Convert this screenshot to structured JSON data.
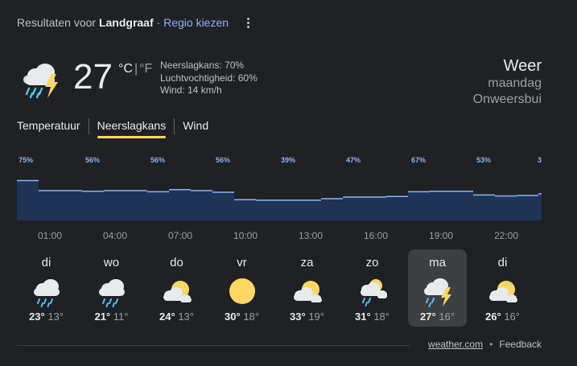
{
  "header": {
    "results_prefix": "Resultaten voor",
    "location": "Landgraaf",
    "separator": "·",
    "region_link": "Regio kiezen",
    "more_icon": "more-vert-icon"
  },
  "current": {
    "icon": "thunderstorm-icon",
    "temperature": "27",
    "unit_c": "°C",
    "unit_sep": "|",
    "unit_f": "°F",
    "precipitation": "Neerslagkans: 70%",
    "humidity": "Luchtvochtigheid: 60%",
    "wind": "Wind: 14 km/h"
  },
  "summary": {
    "title": "Weer",
    "day": "maandag",
    "condition": "Onweersbui"
  },
  "tabs": [
    {
      "label": "Temperatuur"
    },
    {
      "label": "Neerslagkans"
    },
    {
      "label": "Wind"
    }
  ],
  "active_tab": "Neerslagkans",
  "chart_data": {
    "type": "area",
    "series": [
      {
        "values": [
          75,
          56,
          56,
          55,
          56,
          56,
          54,
          58,
          56,
          53,
          39,
          38,
          38,
          38,
          41,
          44,
          44,
          45,
          54,
          55,
          55,
          48,
          46,
          47,
          50,
          41,
          39,
          35
        ]
      }
    ],
    "labels": [
      {
        "index": 0,
        "text": "75%"
      },
      {
        "index": 3,
        "text": "56%"
      },
      {
        "index": 6,
        "text": "56%"
      },
      {
        "index": 9,
        "text": "56%"
      },
      {
        "index": 12,
        "text": "39%"
      },
      {
        "index": 15,
        "text": "47%"
      },
      {
        "index": 18,
        "text": "67%"
      },
      {
        "index": 21,
        "text": "53%"
      },
      {
        "index": 24,
        "text": "3"
      }
    ],
    "x_ticks": [
      "01:00",
      "04:00",
      "07:00",
      "10:00",
      "13:00",
      "16:00",
      "19:00",
      "22:00"
    ],
    "ylim": [
      0,
      100
    ],
    "grid": false
  },
  "days": [
    {
      "name": "di",
      "icon": "rain-icon",
      "high": "23°",
      "low": "13°"
    },
    {
      "name": "wo",
      "icon": "rain-icon",
      "high": "21°",
      "low": "11°"
    },
    {
      "name": "do",
      "icon": "partly-cloudy-icon",
      "high": "24°",
      "low": "13°"
    },
    {
      "name": "vr",
      "icon": "sunny-icon",
      "high": "30°",
      "low": "18°"
    },
    {
      "name": "za",
      "icon": "partly-cloudy-icon",
      "high": "33°",
      "low": "19°"
    },
    {
      "name": "zo",
      "icon": "scattered-showers-icon",
      "high": "31°",
      "low": "18°"
    },
    {
      "name": "ma",
      "icon": "thunderstorm-icon",
      "high": "27°",
      "low": "16°"
    },
    {
      "name": "di",
      "icon": "partly-cloudy-icon",
      "high": "26°",
      "low": "16°"
    }
  ],
  "selected_day": 6,
  "footer": {
    "source": "weather.com",
    "dot": "•",
    "feedback": "Feedback"
  },
  "colors": {
    "background": "#202124",
    "chart_fill": "#1e3356",
    "chart_line": "#8ab4f8",
    "accent": "#fdd663",
    "link": "#8ab4f8"
  }
}
